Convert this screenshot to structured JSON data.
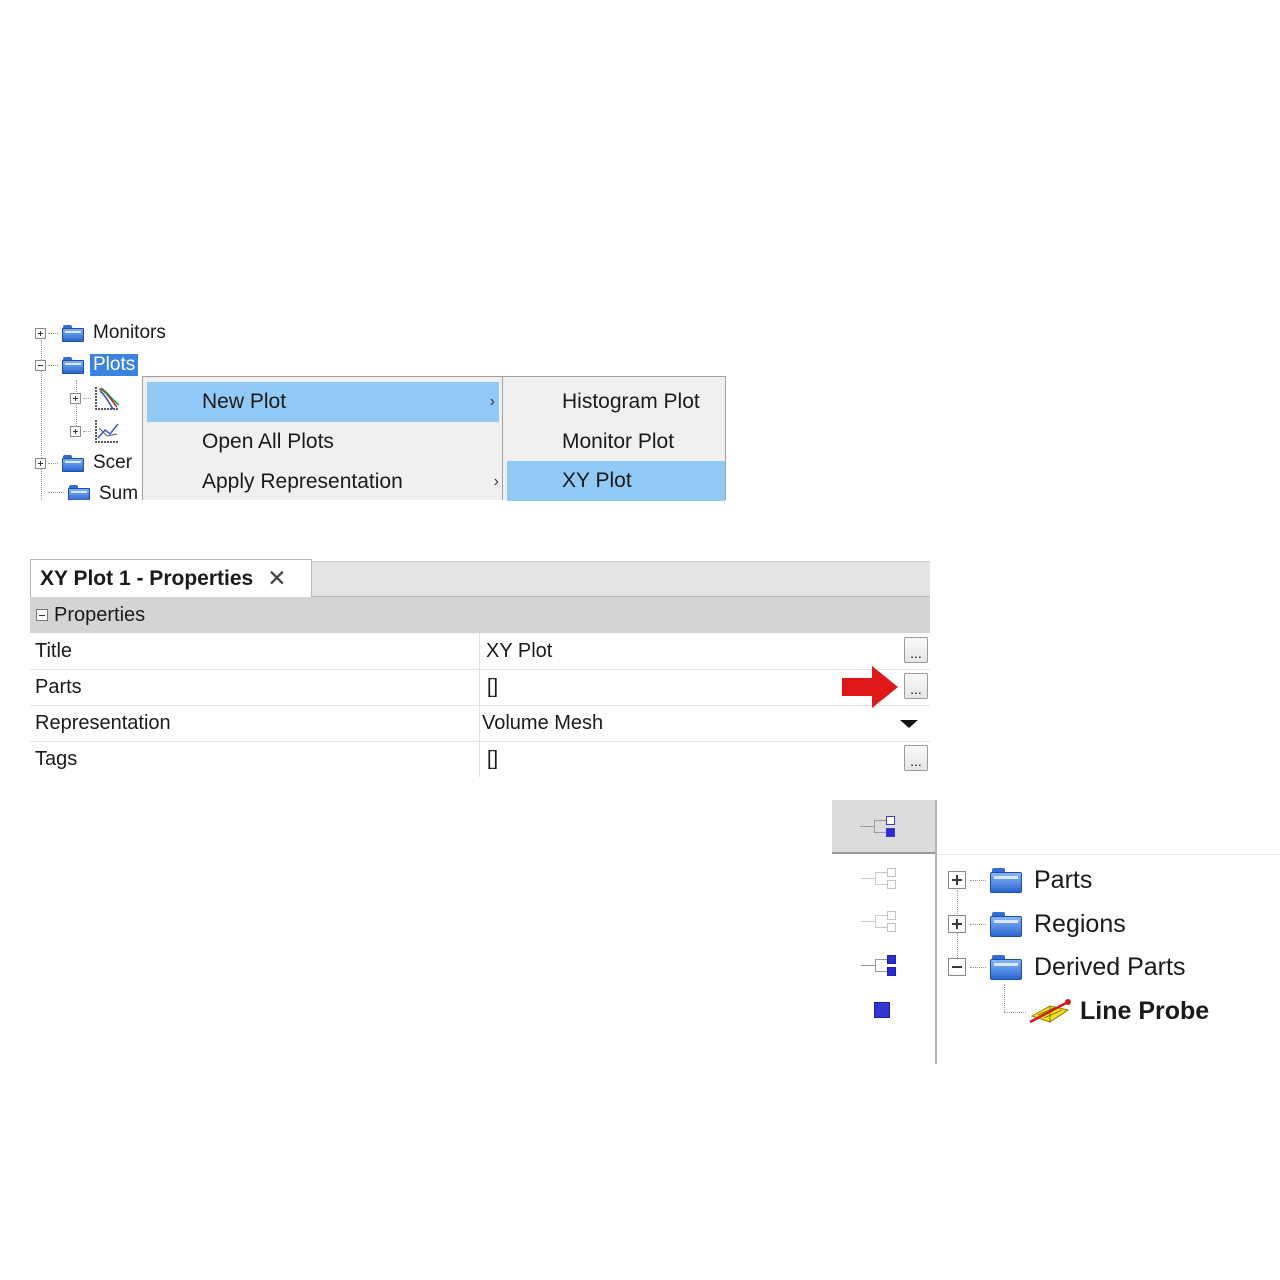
{
  "tree": {
    "items": [
      {
        "label": "Monitors"
      },
      {
        "label": "Plots"
      },
      {
        "label": "Scer"
      },
      {
        "label": "Sum"
      }
    ]
  },
  "context_menu": {
    "items": [
      {
        "label": "New Plot",
        "has_submenu": true
      },
      {
        "label": "Open All Plots",
        "has_submenu": false
      },
      {
        "label": "Apply Representation",
        "has_submenu": true
      }
    ],
    "submenu_arrow": "›"
  },
  "submenu": {
    "items": [
      {
        "label": "Histogram Plot"
      },
      {
        "label": "Monitor Plot"
      },
      {
        "label": "XY Plot"
      }
    ]
  },
  "properties_panel": {
    "tab_title": "XY Plot 1 - Properties",
    "close_glyph": "✕",
    "section_label": "Properties",
    "ellipsis": "...",
    "rows": [
      {
        "key": "Title",
        "value": "XY Plot"
      },
      {
        "key": "Parts",
        "value": "[]"
      },
      {
        "key": "Representation",
        "value": "Volume Mesh"
      },
      {
        "key": "Tags",
        "value": "[]"
      }
    ]
  },
  "object_tree": {
    "items": [
      {
        "label": "Parts"
      },
      {
        "label": "Regions"
      },
      {
        "label": "Derived Parts"
      },
      {
        "label": "Line Probe"
      }
    ]
  },
  "colors": {
    "menu_highlight": "#91c9f7",
    "selection": "#3b83e0",
    "annotation_arrow": "#e01818"
  }
}
